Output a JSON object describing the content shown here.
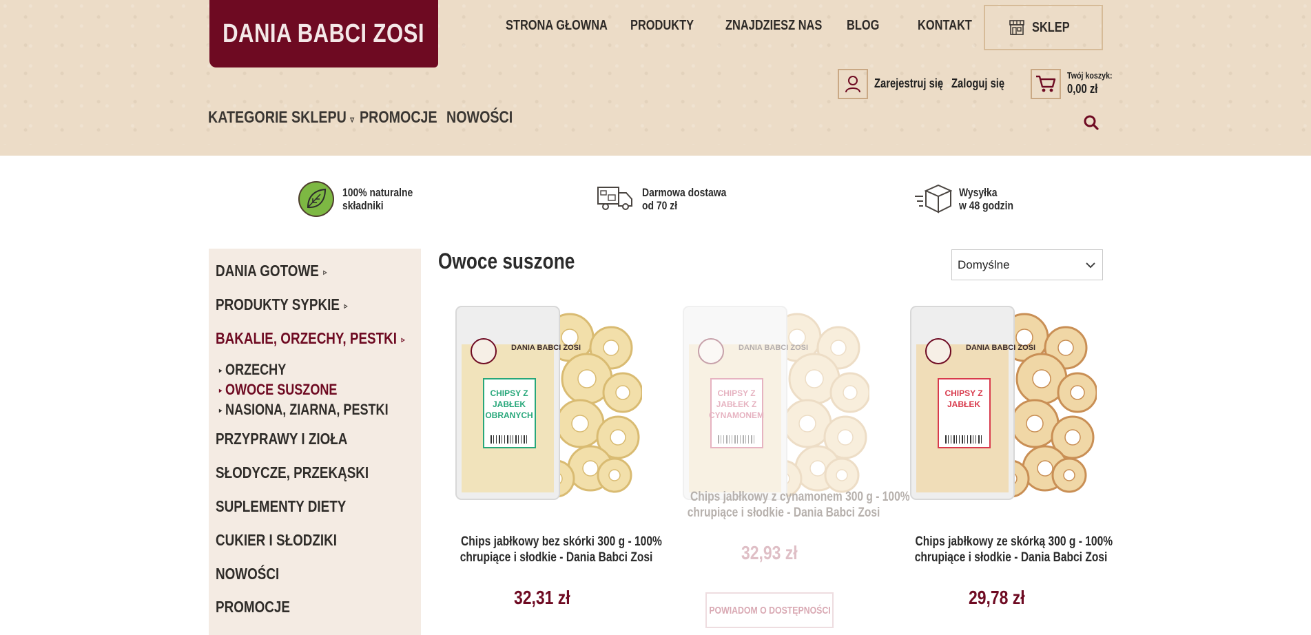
{
  "brand": {
    "logo_text": "DANIA BABCI ZOSI"
  },
  "top_nav": [
    "STRONA GŁOWNA",
    "PRODUKTY",
    "ZNAJDZIESZ NAS",
    "BLOG",
    "KONTAKT"
  ],
  "shop_button": "SKLEP",
  "account": {
    "register": "Zarejestruj się",
    "separator": "/",
    "login": "Zaloguj się"
  },
  "cart": {
    "label": "Twój koszyk:",
    "value": "0,00 zł"
  },
  "category_nav": {
    "categories": "KATEGORIE SKLEPU",
    "promotions": "PROMOCJE",
    "news": "NOWOŚCI"
  },
  "features": [
    {
      "icon": "leaf-icon",
      "line1": "100% naturalne",
      "line2": "składniki"
    },
    {
      "icon": "truck-icon",
      "line1": "Darmowa dostawa",
      "line2": "od 70 zł"
    },
    {
      "icon": "box-icon",
      "line1": "Wysyłka",
      "line2": "w 48 godzin"
    }
  ],
  "sidebar": {
    "items": [
      {
        "label": "DANIA GOTOWE",
        "arrow": "▹"
      },
      {
        "label": "PRODUKTY SYPKIE",
        "arrow": "▹"
      },
      {
        "label": "BAKALIE, ORZECHY, PESTKI",
        "arrow": "▹"
      },
      {
        "label": "PRZYPRAWY I ZIOŁA"
      },
      {
        "label": "SŁODYCZE, PRZEKĄSKI"
      },
      {
        "label": "SUPLEMENTY DIETY"
      },
      {
        "label": "CUKIER I SŁODZIKI"
      },
      {
        "label": "NOWOŚCI"
      },
      {
        "label": "PROMOCJE"
      }
    ],
    "subitems": [
      "ORZECHY",
      "OWOCE SUSZONE",
      "NASIONA, ZIARNA, PESTKI"
    ]
  },
  "main": {
    "title": "Owoce suszone",
    "sort_value": "Domyślne",
    "products": [
      {
        "name_line1": "Chips jabłkowy bez skórki 300 g - 100%",
        "name_line2": "chrupiące i słodkie - Dania Babci Zosi",
        "price": "32,31 zł",
        "pack_label": "CHIPSY Z JABŁEK OBRANYCH",
        "pack_brand": "DANIA BABCI ZOSI",
        "accent": "#27a77a"
      },
      {
        "name_line1": "Chips jabłkowy z cynamonem 300 g - 100%",
        "name_line2": "chrupiące i słodkie - Dania Babci Zosi",
        "price": "32,93 zł",
        "pack_label": "CHIPSY Z JABŁEK Z CYNAMONEM",
        "pack_brand": "DANIA BABCI ZOSI",
        "accent": "#c0395e",
        "notify": "POWIADOM O DOSTĘPNOŚCI"
      },
      {
        "name_line1": "Chips jabłkowy ze skórką 300 g - 100%",
        "name_line2": "chrupiące i słodkie - Dania Babci Zosi",
        "price": "29,78 zł",
        "pack_label": "CHIPSY Z JABŁEK",
        "pack_brand": "DANIA BABCI ZOSI",
        "accent": "#d83a4c"
      }
    ]
  },
  "colors": {
    "brand": "#6e0a22",
    "header_bg": "#ecdcc7",
    "sidebar_bg": "#f4ebe3",
    "leaf_green": "#7db843"
  }
}
